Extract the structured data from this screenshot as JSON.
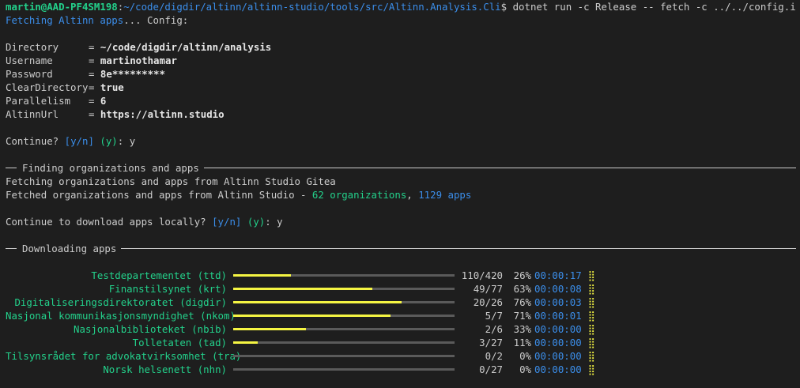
{
  "prompt": {
    "user": "martin@AAD-PF4SM198",
    "sep": ":",
    "path": "~/code/digdir/altinn/altinn-studio/tools/src/Altinn.Analysis.Cli",
    "symbol": "$",
    "command": " dotnet run -c Release -- fetch -c ../../config.ini"
  },
  "fetching": {
    "label": "Fetching Altinn apps",
    "rest": "... Config:"
  },
  "config": [
    {
      "key": "Directory",
      "value": "~/code/digdir/altinn/analysis"
    },
    {
      "key": "Username",
      "value": "martinothamar"
    },
    {
      "key": "Password",
      "value": "8e*********"
    },
    {
      "key": "ClearDirectory",
      "value": "true"
    },
    {
      "key": "Parallelism",
      "value": "6"
    },
    {
      "key": "AltinnUrl",
      "value": "https://altinn.studio"
    }
  ],
  "continue1": {
    "text": "Continue? ",
    "choices": "[y/n]",
    "default": " (y)",
    "colon": ": ",
    "answer": "y"
  },
  "section1": {
    "title": "Finding organizations and apps"
  },
  "gitea_line": "Fetching organizations and apps from Altinn Studio Gitea",
  "fetched": {
    "prefix": "Fetched organizations and apps from Altinn Studio - ",
    "orgs": "62 organizations",
    "comma": ", ",
    "apps": "1129 apps"
  },
  "continue2": {
    "text": "Continue to download apps locally? ",
    "choices": "[y/n]",
    "default": " (y)",
    "colon": ": ",
    "answer": "y"
  },
  "section2": {
    "title": "Downloading apps"
  },
  "downloads": [
    {
      "name": "Testdepartementet (ttd)",
      "count": "110/420",
      "pct": "26%",
      "progress": 0.26,
      "time": "00:00:17",
      "spinner": "⣿"
    },
    {
      "name": "Finanstilsynet (krt)",
      "count": "49/77",
      "pct": "63%",
      "progress": 0.63,
      "time": "00:00:08",
      "spinner": "⣿"
    },
    {
      "name": "Digitaliseringsdirektoratet (digdir)",
      "count": "20/26",
      "pct": "76%",
      "progress": 0.76,
      "time": "00:00:03",
      "spinner": "⣿"
    },
    {
      "name": "Nasjonal kommunikasjonsmyndighet (nkom)",
      "count": "5/7",
      "pct": "71%",
      "progress": 0.71,
      "time": "00:00:01",
      "spinner": "⣿"
    },
    {
      "name": "Nasjonalbiblioteket (nbib)",
      "count": "2/6",
      "pct": "33%",
      "progress": 0.33,
      "time": "00:00:00",
      "spinner": "⣿"
    },
    {
      "name": "Tolletaten (tad)",
      "count": "3/27",
      "pct": "11%",
      "progress": 0.11,
      "time": "00:00:00",
      "spinner": "⣿"
    },
    {
      "name": "Tilsynsrådet for advokatvirksomhet (tra)",
      "count": "0/2",
      "pct": "0%",
      "progress": 0,
      "time": "00:00:00",
      "spinner": "⣿"
    },
    {
      "name": "Norsk helsenett (nhn)",
      "count": "0/27",
      "pct": "0%",
      "progress": 0,
      "time": "00:00:00",
      "spinner": "⣿"
    }
  ],
  "colors": {
    "background": "#1e1e1e",
    "foreground": "#cccccc",
    "green": "#23d18b",
    "blue": "#3b8eea",
    "yellow": "#f5f543"
  }
}
